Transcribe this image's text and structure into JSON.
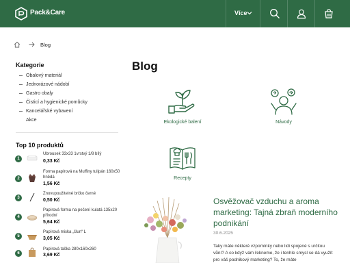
{
  "header": {
    "brand": "Pack&Care",
    "more_label": "Více",
    "icons": [
      "logo-icon",
      "chevron-down-icon",
      "search-icon",
      "user-icon",
      "cart-icon"
    ],
    "background": "#2f6b45"
  },
  "breadcrumb": {
    "current": "Blog"
  },
  "sidebar": {
    "categories_title": "Kategorie",
    "categories": [
      "Obalový materiál",
      "Jednorázové nádobí",
      "Gastro obaly",
      "Čisticí a hygienické pomůcky",
      "Kancelářské vybavení",
      "Akce"
    ],
    "top_title": "Top 10 produktů",
    "top_products": [
      {
        "rank": "1",
        "name": "Ubrousek 33x33 1vrstvý 1/8 bílý",
        "price": "0,33 Kč"
      },
      {
        "rank": "2",
        "name": "Forma papírová na Muffiny tulipán 160x50 hnědá",
        "price": "1,56 Kč"
      },
      {
        "rank": "3",
        "name": "Znovupoužitelné brčko černé",
        "price": "0,50 Kč"
      },
      {
        "rank": "4",
        "name": "Papírová forma na pečení kulatá 135x20 přírodní",
        "price": "5,64 Kč"
      },
      {
        "rank": "5",
        "name": "Papírová miska „člun“ L",
        "price": "3,05 Kč"
      },
      {
        "rank": "6",
        "name": "Papírová taška 280x160x260",
        "price": "3,69 Kč"
      }
    ]
  },
  "main": {
    "title": "Blog",
    "blog_categories": [
      {
        "label": "Ekologické balení",
        "icon": "eco-hand-plant-icon"
      },
      {
        "label": "Návody",
        "icon": "thinking-person-icon"
      },
      {
        "label": "Recepty",
        "icon": "recipe-book-icon"
      }
    ],
    "post": {
      "title": "Osvěžovač vzduchu a aroma marketing: Tajná zbraň moderního podnikání",
      "date": "30.6.2025",
      "excerpt": "Taky máte některé vzpomínky nebo lidi spojené s určitou vůní? A co když vám řekneme, že i tenhle smysl se dá využít pro váš podnikový marketing? To, že máte"
    }
  },
  "colors": {
    "brand_green": "#2f6b45",
    "text": "#222222",
    "muted": "#888888"
  }
}
